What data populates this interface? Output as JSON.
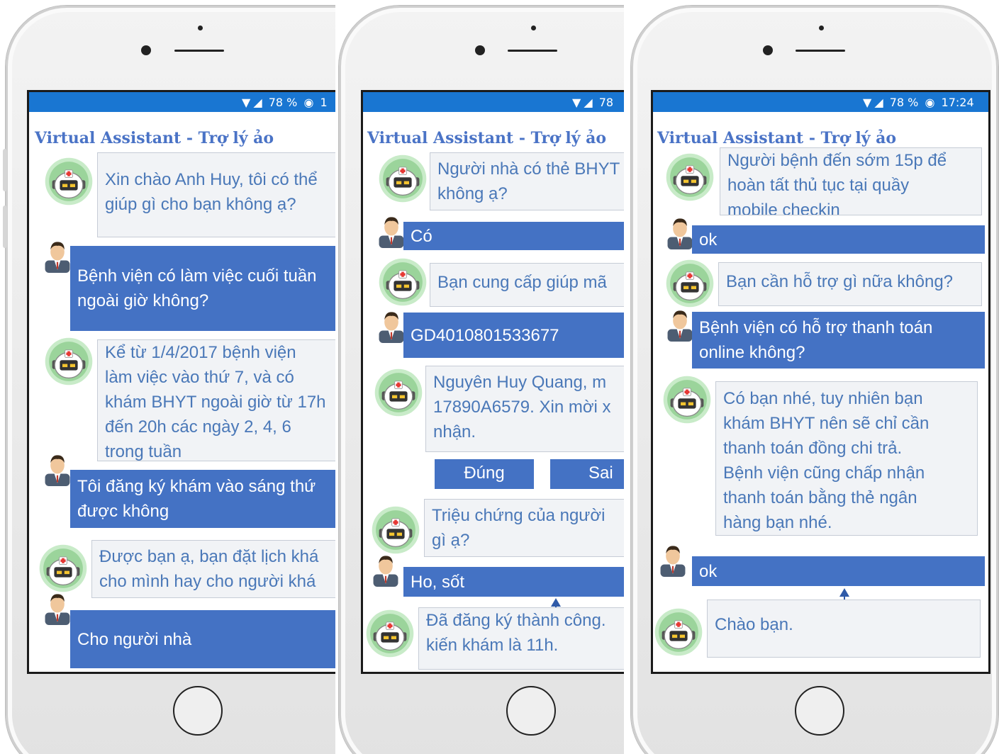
{
  "app": {
    "title": "Virtual Assistant - Trợ lý ảo"
  },
  "colors": {
    "status_bar": "#1976d2",
    "user_bubble": "#4472c4",
    "bot_text": "#4a78b8",
    "title": "#4a73c6"
  },
  "icons": {
    "bot_avatar": "robot-nurse-icon",
    "user_avatar": "man-in-suit-icon",
    "wifi": "wifi-icon",
    "signal": "signal-icon",
    "battery": "battery-icon"
  },
  "phones": [
    {
      "status": {
        "battery": "78 %",
        "time": "1"
      },
      "messages": [
        {
          "sender": "bot",
          "text": "Xin chào Anh Huy, tôi có thể\ngiúp gì cho bạn không ạ?"
        },
        {
          "sender": "user",
          "text": "Bệnh viện có làm việc cuối tuần\nngoài giờ không?"
        },
        {
          "sender": "bot",
          "text": "Kể từ 1/4/2017 bệnh viện\nlàm việc vào thứ 7, và có\nkhám BHYT ngoài giờ từ 17h\nđến 20h các ngày 2, 4, 6\ntrong tuần"
        },
        {
          "sender": "user",
          "text": "Tôi đăng ký khám vào sáng thứ\nđược không"
        },
        {
          "sender": "bot",
          "text": "Được bạn ạ, bạn đặt lịch khá\ncho mình hay cho người khá"
        },
        {
          "sender": "user",
          "text": "Cho người nhà"
        }
      ]
    },
    {
      "status": {
        "battery": "78"
      },
      "messages": [
        {
          "sender": "bot",
          "text": "Người nhà có thẻ BHYT\nkhông ạ?"
        },
        {
          "sender": "user",
          "text": "Có"
        },
        {
          "sender": "bot",
          "text": "Bạn cung cấp giúp mã"
        },
        {
          "sender": "user",
          "text": "GD4010801533677"
        },
        {
          "sender": "bot",
          "text": "Nguyên Huy Quang, m\n17890A6579. Xin mời x\nnhận."
        },
        {
          "sender": "bot",
          "text": "Triệu chứng của người\ngì ạ?"
        },
        {
          "sender": "user",
          "text": "Ho, sốt"
        },
        {
          "sender": "bot",
          "text": "Đã đăng ký thành công.\nkiến khám là 11h."
        }
      ],
      "buttons": {
        "confirm": "Đúng",
        "reject": "Sai"
      }
    },
    {
      "status": {
        "battery": "78 %",
        "time": "17:24"
      },
      "messages": [
        {
          "sender": "bot",
          "text": "Người bệnh đến sớm 15p để\nhoàn tất thủ tục tại quầy\nmobile checkin"
        },
        {
          "sender": "user",
          "text": "ok"
        },
        {
          "sender": "bot",
          "text": "Bạn cần hỗ trợ gì nữa không?"
        },
        {
          "sender": "user",
          "text": "Bệnh viện có hỗ trợ thanh toán\nonline không?"
        },
        {
          "sender": "bot",
          "text": "Có bạn nhé, tuy nhiên bạn\nkhám BHYT nên sẽ chỉ cần\nthanh toán đồng chi trả.\nBệnh viện cũng chấp nhận\nthanh toán bằng thẻ ngân\nhàng bạn nhé."
        },
        {
          "sender": "user",
          "text": "ok"
        },
        {
          "sender": "bot",
          "text": "Chào bạn."
        }
      ]
    }
  ]
}
